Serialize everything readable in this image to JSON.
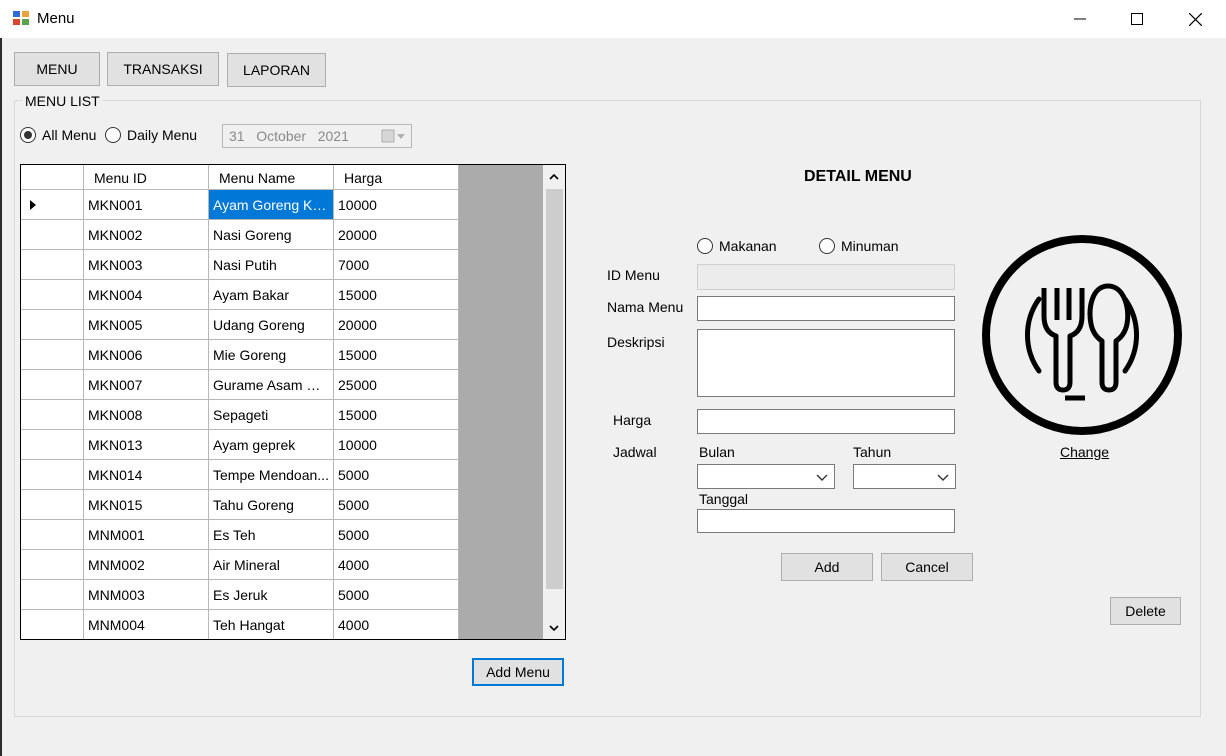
{
  "window": {
    "title": "Menu"
  },
  "nav": {
    "menu": "MENU",
    "transaksi": "TRANSAKSI",
    "laporan": "LAPORAN"
  },
  "menu_list": {
    "group_label": "MENU LIST",
    "all_menu": "All Menu",
    "daily_menu": "Daily Menu",
    "selected_filter": "All Menu",
    "date": {
      "day": "31",
      "month": "October",
      "year": "2021"
    }
  },
  "grid": {
    "columns": [
      "Menu ID",
      "Menu Name",
      "Harga"
    ],
    "rows": [
      [
        "MKN001",
        "Ayam Goreng Kal...",
        "10000"
      ],
      [
        "MKN002",
        "Nasi Goreng",
        "20000"
      ],
      [
        "MKN003",
        "Nasi Putih",
        "7000"
      ],
      [
        "MKN004",
        "Ayam Bakar",
        "15000"
      ],
      [
        "MKN005",
        "Udang Goreng",
        "20000"
      ],
      [
        "MKN006",
        "Mie Goreng",
        "15000"
      ],
      [
        "MKN007",
        "Gurame Asam M...",
        "25000"
      ],
      [
        "MKN008",
        "Sepageti",
        "15000"
      ],
      [
        "MKN013",
        "Ayam geprek",
        "10000"
      ],
      [
        "MKN014",
        "Tempe Mendoan...",
        "5000"
      ],
      [
        "MKN015",
        "Tahu Goreng",
        "5000"
      ],
      [
        "MNM001",
        "Es Teh",
        "5000"
      ],
      [
        "MNM002",
        "Air Mineral",
        "4000"
      ],
      [
        "MNM003",
        "Es Jeruk",
        "5000"
      ],
      [
        "MNM004",
        "Teh Hangat",
        "4000"
      ]
    ]
  },
  "actions": {
    "add_menu": "Add Menu",
    "add": "Add",
    "cancel": "Cancel",
    "delete": "Delete",
    "change": "Change"
  },
  "detail": {
    "title": "DETAIL MENU",
    "makanan": "Makanan",
    "minuman": "Minuman",
    "id_menu_label": "ID Menu",
    "nama_menu_label": "Nama Menu",
    "deskripsi_label": "Deskripsi",
    "harga_label": "Harga",
    "jadwal_label": "Jadwal",
    "bulan_label": "Bulan",
    "tahun_label": "Tahun",
    "tanggal_label": "Tanggal",
    "id_menu_value": "",
    "nama_menu_value": "",
    "deskripsi_value": "",
    "harga_value": "",
    "bulan_value": "",
    "tahun_value": "",
    "tanggal_value": ""
  },
  "icons": {
    "app": "app-icon",
    "food": "fork-spoon-plate-icon",
    "calendar": "calendar-icon"
  },
  "colors": {
    "selection": "#0078d7",
    "grid_background": "#ababab",
    "window": "#f0f0f0"
  }
}
